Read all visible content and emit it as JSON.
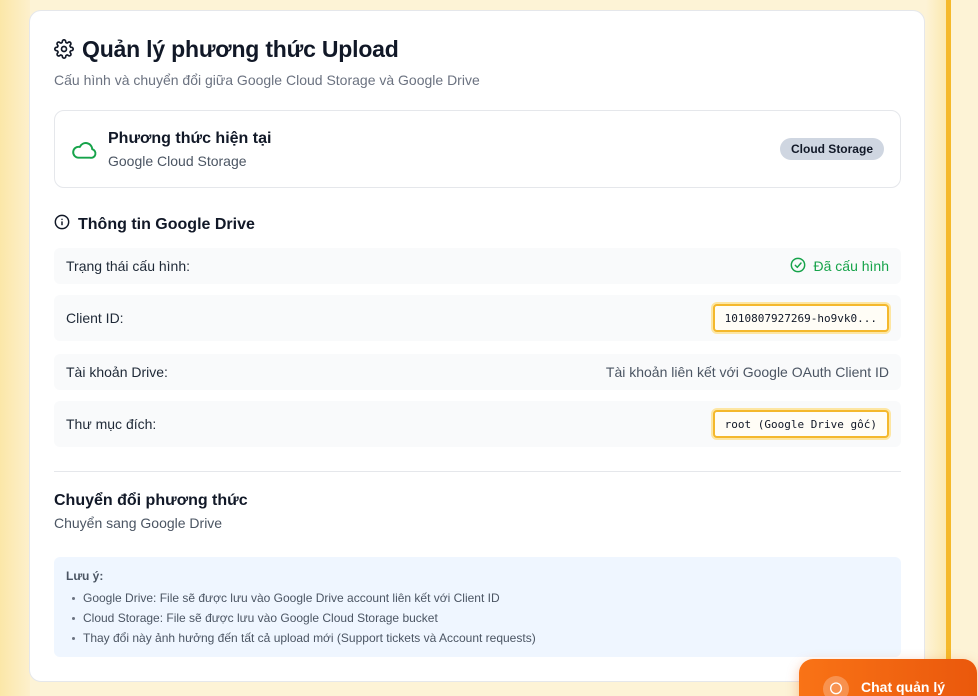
{
  "header": {
    "title": "Quản lý phương thức Upload",
    "subtitle": "Cấu hình và chuyển đổi giữa Google Cloud Storage và Google Drive",
    "icon": "gear-icon"
  },
  "current_method": {
    "title": "Phương thức hiện tại",
    "value": "Google Cloud Storage",
    "badge": "Cloud Storage",
    "icon": "cloud-icon",
    "icon_color": "#16a34a"
  },
  "drive_info": {
    "heading": "Thông tin Google Drive",
    "icon": "info-icon",
    "rows": {
      "status": {
        "label": "Trạng thái cấu hình:",
        "value": "Đã cấu hình",
        "color": "#16a34a"
      },
      "client_id": {
        "label": "Client ID:",
        "value": "1010807927269-ho9vk0..."
      },
      "account": {
        "label": "Tài khoản Drive:",
        "value": "Tài khoản liên kết với Google OAuth Client ID"
      },
      "folder": {
        "label": "Thư mục đích:",
        "value": "root (Google Drive gốc)"
      }
    }
  },
  "switch": {
    "title": "Chuyển đổi phương thức",
    "subtitle": "Chuyển sang Google Drive"
  },
  "note": {
    "title": "Lưu ý:",
    "items": [
      "Google Drive: File sẽ được lưu vào Google Drive account liên kết với Client ID",
      "Cloud Storage: File sẽ được lưu vào Google Cloud Storage bucket",
      "Thay đổi này ảnh hưởng đến tất cả upload mới (Support tickets và Account requests)"
    ]
  },
  "chat": {
    "label": "Chat quản lý",
    "icon": "chat-icon",
    "color": "#f97316"
  },
  "colors": {
    "highlight": "#f4b82c",
    "rail": "#f5b92b"
  }
}
